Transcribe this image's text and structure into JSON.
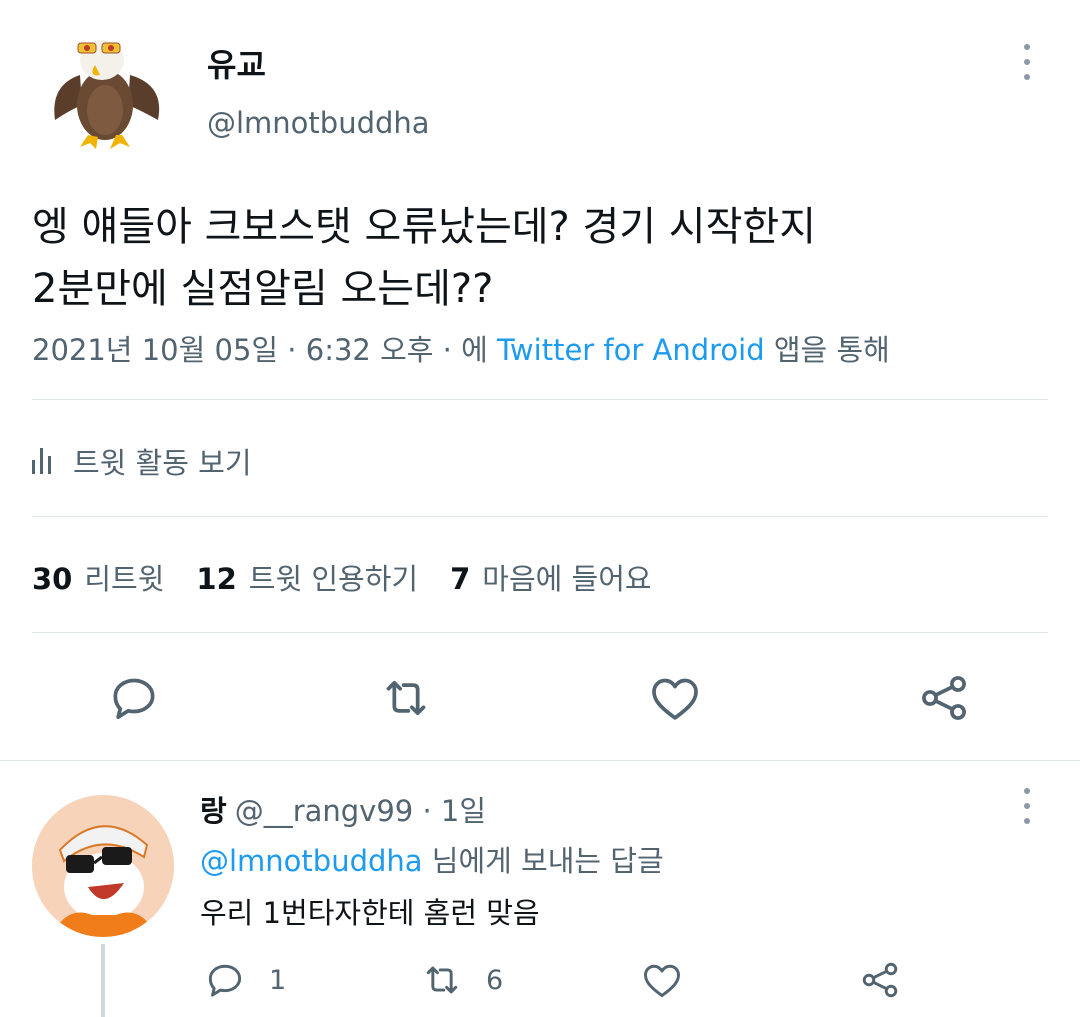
{
  "tweet": {
    "display_name": "유교",
    "handle": "@lmnotbuddha",
    "text_lines": [
      "엥 얘들아 크보스탯 오류났는데? 경기 시작한지",
      "2분만에 실점알림 오는데??"
    ],
    "meta": {
      "date": "2021년 10월 05일",
      "sep1": " · ",
      "time": "6:32 오후",
      "sep2": " · 에 ",
      "source": "Twitter for Android",
      "suffix": " 앱을 통해"
    },
    "activity_label": "트윗 활동 보기",
    "stats": {
      "retweets_count": "30",
      "retweets_label": "리트윗",
      "quotes_count": "12",
      "quotes_label": "트윗 인용하기",
      "likes_count": "7",
      "likes_label": "마음에 들어요"
    },
    "actions": [
      "reply-icon",
      "retweet-icon",
      "like-icon",
      "share-icon"
    ]
  },
  "reply": {
    "display_name": "랑",
    "handle": "@__rangv99",
    "time": "· 1일",
    "reply_to_handle": "@lmnotbuddha",
    "reply_to_suffix": " 님에게 보내는 답글",
    "text": "우리 1번타자한테 홈런 맞음",
    "reply_count": "1",
    "retweet_count": "6"
  },
  "colors": {
    "text": "#0f1419",
    "secondary": "#536471",
    "link": "#1d9bf0",
    "divider": "#e1e6ea"
  }
}
